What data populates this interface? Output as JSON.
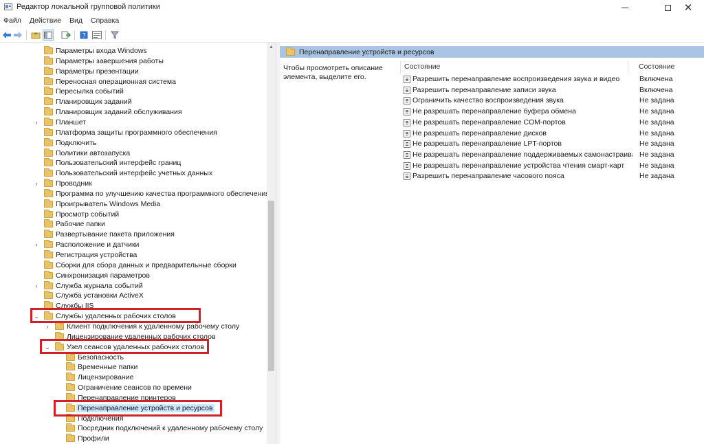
{
  "window": {
    "title": "Редактор локальной групповой политики"
  },
  "menu": [
    "Файл",
    "Действие",
    "Вид",
    "Справка"
  ],
  "tree": {
    "items": [
      {
        "label": "Параметры входа Windows",
        "expander": ""
      },
      {
        "label": "Параметры завершения работы",
        "expander": ""
      },
      {
        "label": "Параметры презентации",
        "expander": ""
      },
      {
        "label": "Переносная операционная система",
        "expander": ""
      },
      {
        "label": "Пересылка событий",
        "expander": ""
      },
      {
        "label": "Планировщик заданий",
        "expander": ""
      },
      {
        "label": "Планировщик заданий обслуживания",
        "expander": ""
      },
      {
        "label": "Планшет",
        "expander": "›"
      },
      {
        "label": "Платформа защиты программного обеспечения",
        "expander": ""
      },
      {
        "label": "Подключить",
        "expander": ""
      },
      {
        "label": "Политики автозапуска",
        "expander": ""
      },
      {
        "label": "Пользовательский интерфейс границ",
        "expander": ""
      },
      {
        "label": "Пользовательский интерфейс учетных данных",
        "expander": ""
      },
      {
        "label": "Проводник",
        "expander": "›"
      },
      {
        "label": "Программа по улучшению качества программного обеспечения W",
        "expander": ""
      },
      {
        "label": "Проигрыватель Windows Media",
        "expander": ""
      },
      {
        "label": "Просмотр событий",
        "expander": ""
      },
      {
        "label": "Рабочие папки",
        "expander": ""
      },
      {
        "label": "Развертывание пакета приложения",
        "expander": ""
      },
      {
        "label": "Расположение и датчики",
        "expander": "›"
      },
      {
        "label": "Регистрация устройства",
        "expander": ""
      },
      {
        "label": "Сборки для сбора данных и предварительные сборки",
        "expander": ""
      },
      {
        "label": "Синхронизация параметров",
        "expander": ""
      },
      {
        "label": "Служба журнала событий",
        "expander": "›"
      },
      {
        "label": "Служба установки ActiveX",
        "expander": ""
      },
      {
        "label": "Службы IIS",
        "expander": ""
      },
      {
        "label": "Службы удаленных рабочих столов",
        "expander": "⌄"
      },
      {
        "label": "Клиент подключения к удаленному рабочему столу",
        "expander": "›"
      },
      {
        "label": "Лицензирование удаленных рабочих столов",
        "expander": ""
      },
      {
        "label": "Узел сеансов удаленных рабочих столов",
        "expander": "⌄"
      },
      {
        "label": "Безопасность",
        "expander": ""
      },
      {
        "label": "Временные папки",
        "expander": ""
      },
      {
        "label": "Лицензирование",
        "expander": ""
      },
      {
        "label": "Ограничение сеансов по времени",
        "expander": ""
      },
      {
        "label": "Перенаправление принтеров",
        "expander": ""
      },
      {
        "label": "Перенаправление устройств и ресурсов",
        "expander": "",
        "selected": true
      },
      {
        "label": "Подключения",
        "expander": ""
      },
      {
        "label": "Посредник подключений к удаленному рабочему столу",
        "expander": ""
      },
      {
        "label": "Профили",
        "expander": ""
      }
    ]
  },
  "right": {
    "header_title": "Перенаправление устройств и ресурсов",
    "description": "Чтобы просмотреть описание элемента, выделите его.",
    "columns": {
      "name": "Состояние",
      "state": "Состояние"
    },
    "policies": [
      {
        "name": "Разрешить перенаправление воспроизведения звука и видео",
        "state": "Включена"
      },
      {
        "name": "Разрешить перенаправление записи звука",
        "state": "Включена"
      },
      {
        "name": "Ограничить качество воспроизведения звука",
        "state": "Не задана"
      },
      {
        "name": "Не разрешать перенаправление буфера обмена",
        "state": "Не задана"
      },
      {
        "name": "Не разрешать перенаправление COM-портов",
        "state": "Не задана"
      },
      {
        "name": "Не разрешать перенаправление дисков",
        "state": "Не задана"
      },
      {
        "name": "Не разрешать перенаправление LPT-портов",
        "state": "Не задана"
      },
      {
        "name": "Не разрешать перенаправление поддерживаемых самонастраива...",
        "state": "Не задана"
      },
      {
        "name": "Не разрешать перенаправление устройства чтения смарт-карт",
        "state": "Не задана"
      },
      {
        "name": "Разрешить перенаправление часового пояса",
        "state": "Не задана"
      }
    ]
  },
  "colors": {
    "highlight": "#d0202a",
    "header": "#a9c4e4",
    "selection": "#cce8ff"
  }
}
